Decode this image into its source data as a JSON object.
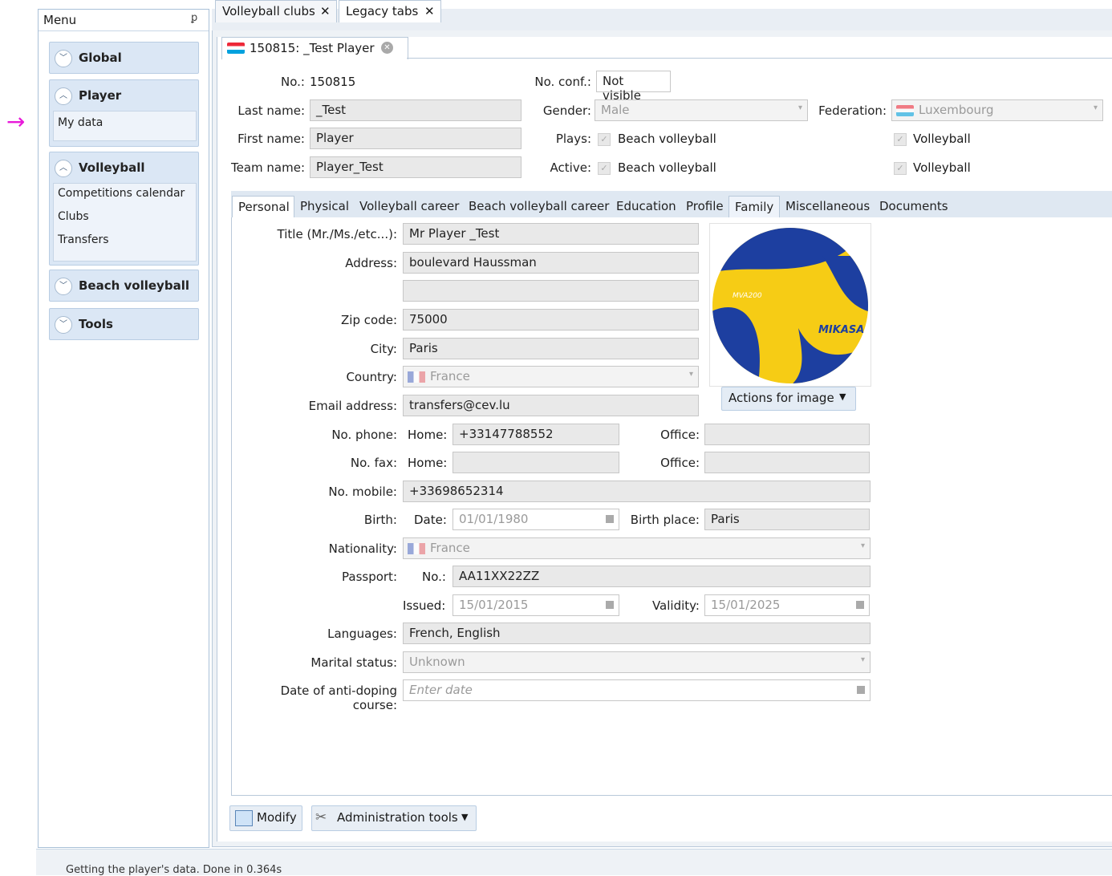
{
  "menu": {
    "title": "Menu",
    "groups": [
      {
        "title": "Global",
        "expanded": false,
        "items": []
      },
      {
        "title": "Player",
        "expanded": true,
        "items": [
          "My data"
        ]
      },
      {
        "title": "Volleyball",
        "expanded": true,
        "items": [
          "Competitions calendar",
          "Clubs",
          "Transfers"
        ]
      },
      {
        "title": "Beach volleyball",
        "expanded": false,
        "items": []
      },
      {
        "title": "Tools",
        "expanded": false,
        "items": []
      }
    ]
  },
  "top_tabs": [
    {
      "label": "Volleyball clubs",
      "close": "✕"
    },
    {
      "label": "Legacy tabs",
      "close": "✕"
    }
  ],
  "player_tab": {
    "label": "150815: _Test Player"
  },
  "header": {
    "no_label": "No.:",
    "no_value": "150815",
    "noconf_label": "No. conf.:",
    "noconf_value": "Not visible",
    "lastname_label": "Last name:",
    "lastname_value": "_Test",
    "firstname_label": "First name:",
    "firstname_value": "Player",
    "teamname_label": "Team name:",
    "teamname_value": "Player_Test",
    "gender_label": "Gender:",
    "gender_value": "Male",
    "federation_label": "Federation:",
    "federation_value": "Luxembourg",
    "plays_label": "Plays:",
    "active_label": "Active:",
    "beach_label": "Beach volleyball",
    "volley_label": "Volleyball"
  },
  "inner_tabs": [
    "Personal",
    "Physical",
    "Volleyball career",
    "Beach volleyball career",
    "Education",
    "Profile",
    "Family",
    "Miscellaneous",
    "Documents"
  ],
  "form": {
    "title_label": "Title (Mr./Ms./etc...):",
    "title_value": "Mr Player _Test",
    "address_label": "Address:",
    "address_value": "boulevard Haussman",
    "address2_value": "",
    "zip_label": "Zip code:",
    "zip_value": "75000",
    "city_label": "City:",
    "city_value": "Paris",
    "country_label": "Country:",
    "country_value": "France",
    "email_label": "Email address:",
    "email_value": "transfers@cev.lu",
    "phone_label": "No. phone:",
    "home_label": "Home:",
    "phone_home": "+33147788552",
    "office_label": "Office:",
    "phone_office": "",
    "fax_label": "No. fax:",
    "fax_home": "",
    "fax_office": "",
    "mobile_label": "No. mobile:",
    "mobile_value": "+33698652314",
    "birth_label": "Birth:",
    "date_label": "Date:",
    "birth_date": "01/01/1980",
    "birthplace_label": "Birth place:",
    "birthplace_value": "Paris",
    "nationality_label": "Nationality:",
    "nationality_value": "France",
    "passport_label": "Passport:",
    "passport_no_label": "No.:",
    "passport_no": "AA11XX22ZZ",
    "issued_label": "Issued:",
    "issued_value": "15/01/2015",
    "validity_label": "Validity:",
    "validity_value": "15/01/2025",
    "languages_label": "Languages:",
    "languages_value": "French, English",
    "marital_label": "Marital status:",
    "marital_value": "Unknown",
    "antidoping_label": "Date of anti-doping course:",
    "antidoping_placeholder": "Enter date"
  },
  "image_actions": "Actions for image",
  "ball_text": {
    "brand": "MIKASA",
    "model": "MVA200"
  },
  "buttons": {
    "modify": "Modify",
    "admin": "Administration tools"
  },
  "status": "Getting the player's data. Done in 0.364s"
}
